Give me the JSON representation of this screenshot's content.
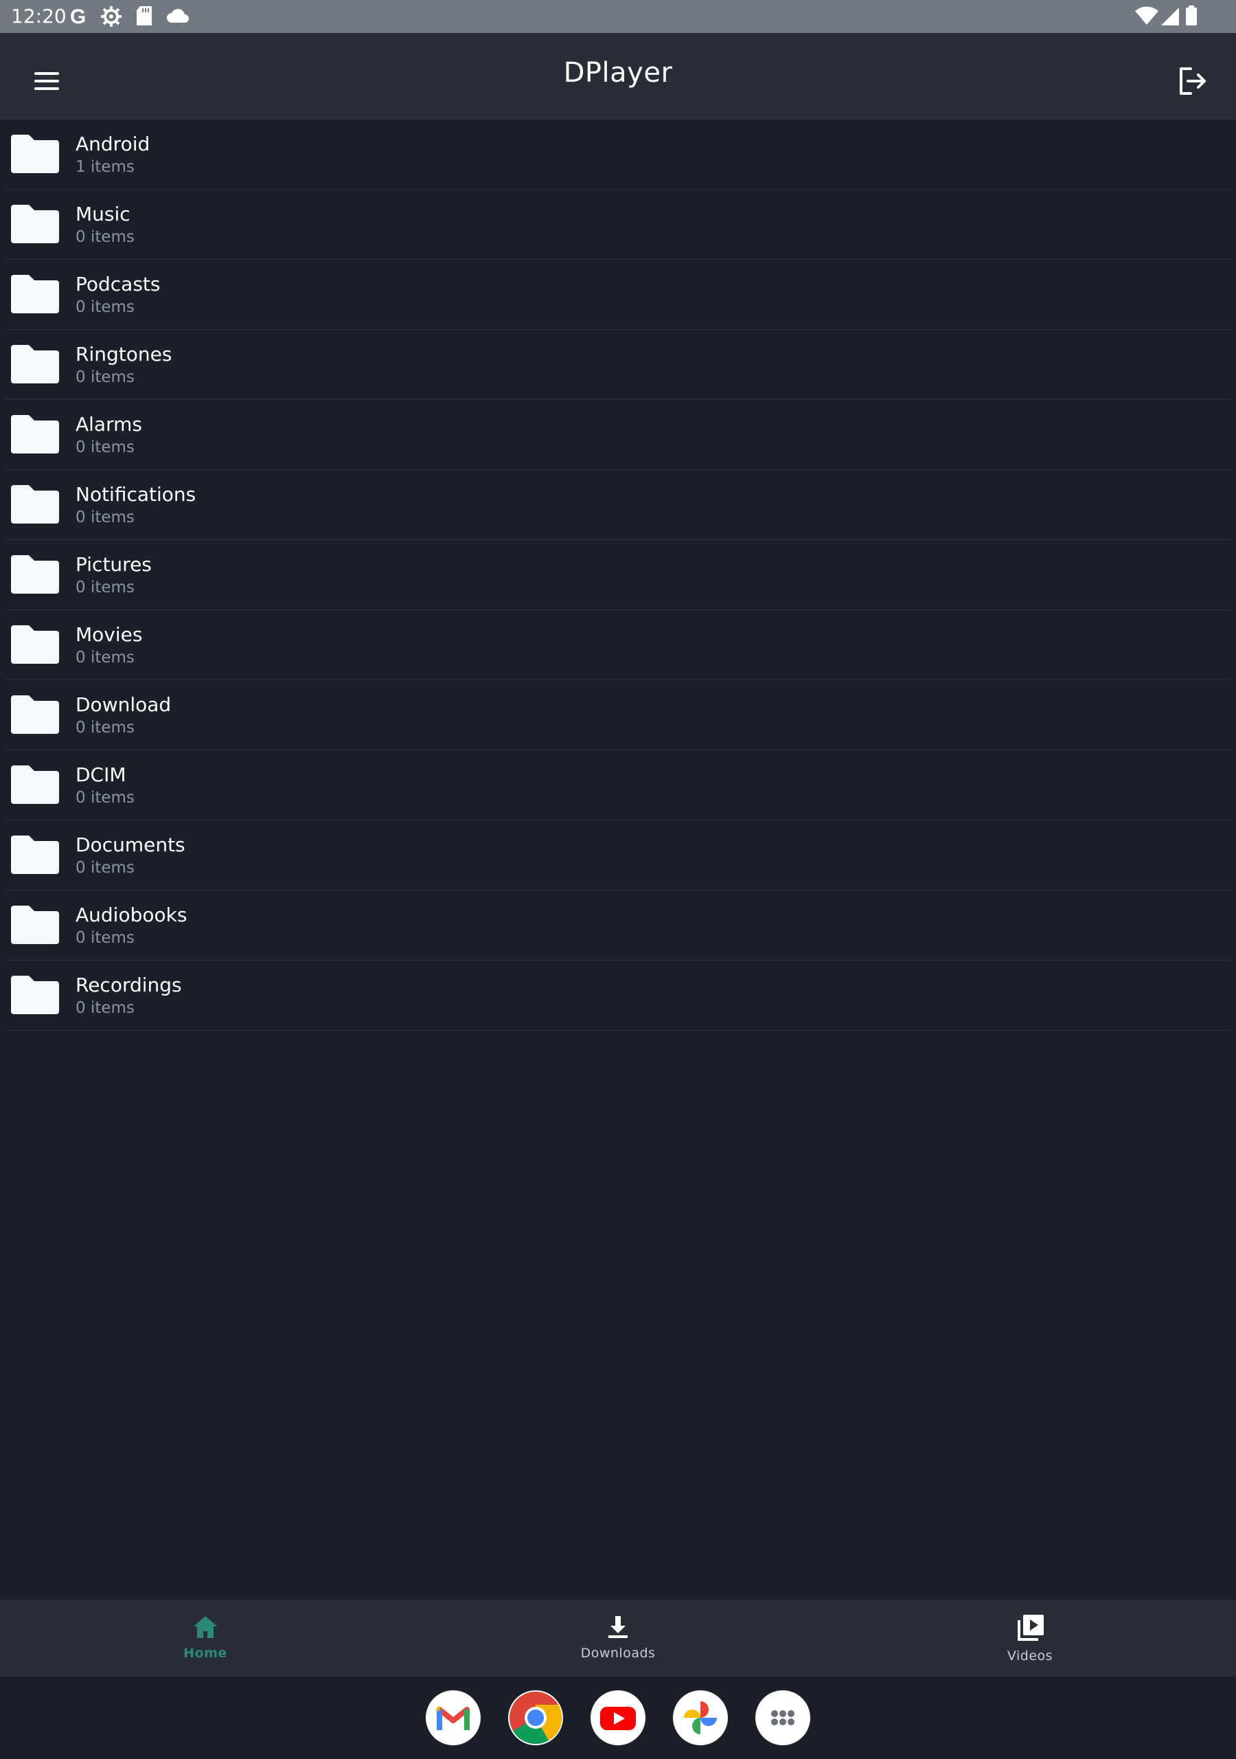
{
  "status_bar": {
    "time": "12:20",
    "left_icons": [
      "google-icon",
      "settings-icon",
      "sd-card-icon",
      "cloud-icon"
    ],
    "right_icons": [
      "wifi-icon",
      "cellular-signal-icon",
      "battery-icon"
    ]
  },
  "app_bar": {
    "title": "DPlayer",
    "menu_icon": "hamburger-menu-icon",
    "action_icon": "logout-icon"
  },
  "folders": [
    {
      "name": "Android",
      "count": "1 items"
    },
    {
      "name": "Music",
      "count": "0 items"
    },
    {
      "name": "Podcasts",
      "count": "0 items"
    },
    {
      "name": "Ringtones",
      "count": "0 items"
    },
    {
      "name": "Alarms",
      "count": "0 items"
    },
    {
      "name": "Notifications",
      "count": "0 items"
    },
    {
      "name": "Pictures",
      "count": "0 items"
    },
    {
      "name": "Movies",
      "count": "0 items"
    },
    {
      "name": "Download",
      "count": "0 items"
    },
    {
      "name": "DCIM",
      "count": "0 items"
    },
    {
      "name": "Documents",
      "count": "0 items"
    },
    {
      "name": "Audiobooks",
      "count": "0 items"
    },
    {
      "name": "Recordings",
      "count": "0 items"
    }
  ],
  "bottom_nav": [
    {
      "label": "Home",
      "icon": "home-icon",
      "active": true
    },
    {
      "label": "Downloads",
      "icon": "download-icon",
      "active": false
    },
    {
      "label": "Videos",
      "icon": "video-library-icon",
      "active": false
    }
  ],
  "dock_apps": [
    "gmail-icon",
    "chrome-icon",
    "youtube-icon",
    "photos-icon",
    "app-drawer-icon"
  ],
  "colors": {
    "background": "#1b1f29",
    "app_bar": "#282d38",
    "status_bar": "#737982",
    "accent": "#2a8a76",
    "secondary_text": "#8d93a0"
  }
}
